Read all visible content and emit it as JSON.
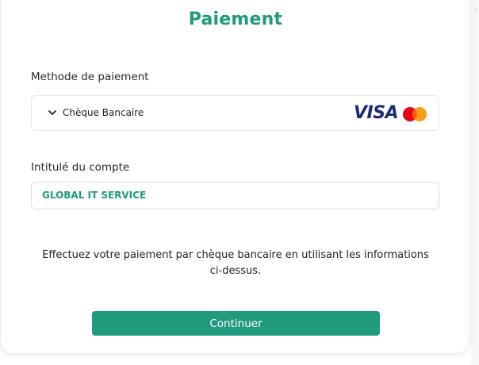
{
  "header": {
    "title": "Paiement"
  },
  "payment_method": {
    "label": "Methode de paiement",
    "selected": "Chèque Bancaire",
    "brands": {
      "visa_text": "VISA",
      "mastercard": "mastercard-logo"
    }
  },
  "account": {
    "label": "Intitulé du compte",
    "value": "GLOBAL IT SERVICE"
  },
  "info_text": "Effectuez votre paiement par chèque bancaire en utilisant les informations ci-dessus.",
  "actions": {
    "continue_label": "Continuer"
  },
  "colors": {
    "accent": "#1f9a7d",
    "visa_blue": "#1a2d7a",
    "mastercard_red": "#eb001b",
    "mastercard_orange": "#f79e1b"
  }
}
